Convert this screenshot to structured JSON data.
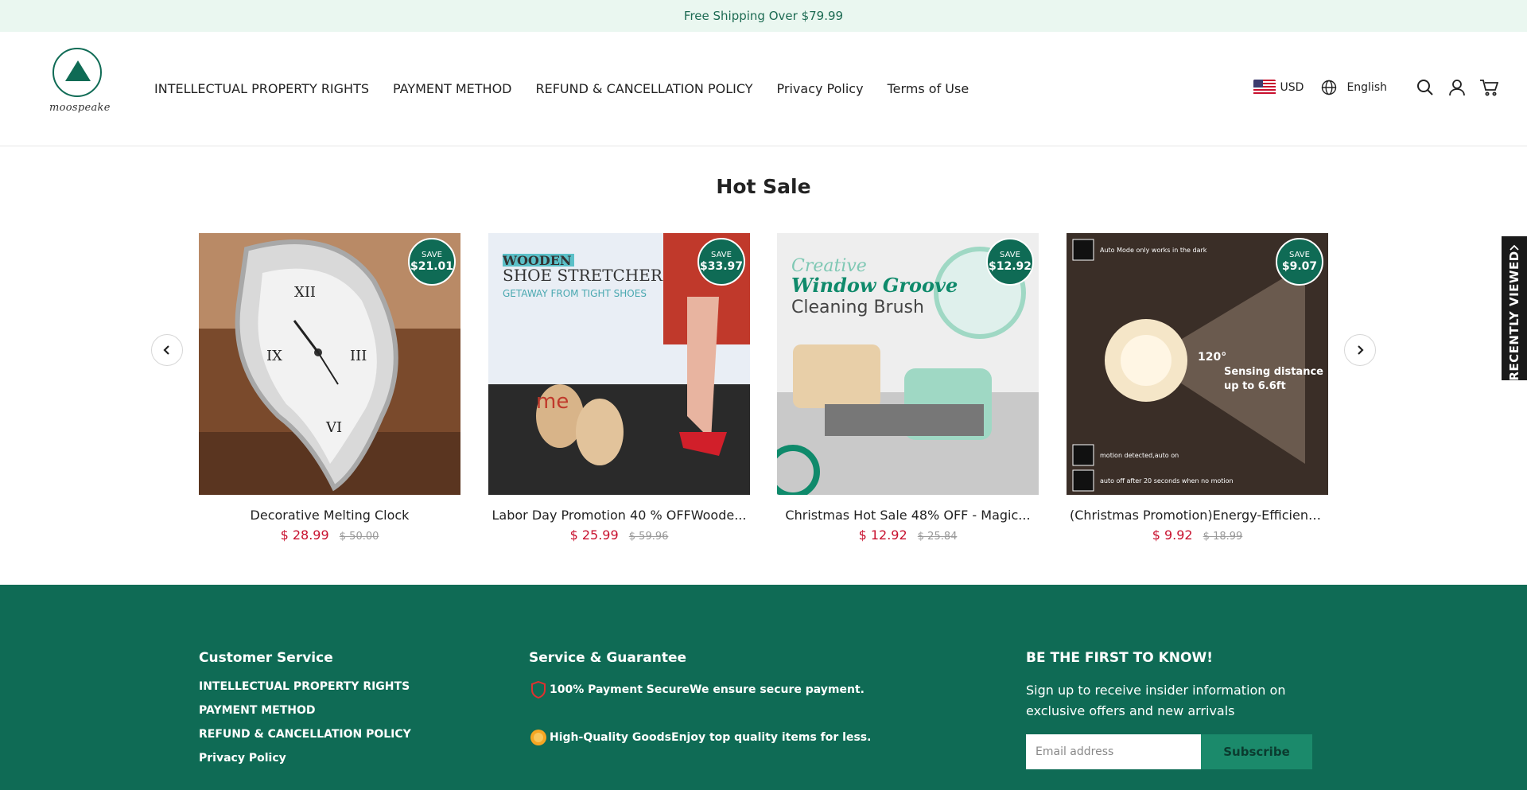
{
  "announcement": {
    "text": "Free Shipping Over $79.99"
  },
  "brand": {
    "name": "moospeake"
  },
  "nav": {
    "items": [
      {
        "label": "INTELLECTUAL PROPERTY RIGHTS"
      },
      {
        "label": "PAYMENT METHOD"
      },
      {
        "label": "REFUND & CANCELLATION POLICY"
      },
      {
        "label": "Privacy Policy"
      },
      {
        "label": "Terms of Use"
      }
    ]
  },
  "utility": {
    "currency": "USD",
    "language": "English",
    "icons": [
      "us-flag-icon",
      "globe-icon",
      "search-icon",
      "account-icon",
      "cart-icon"
    ]
  },
  "section": {
    "title": "Hot Sale"
  },
  "products": [
    {
      "name": "Decorative Melting Clock",
      "price": "$ 28.99",
      "compare": "$ 50.00",
      "save_label": "SAVE",
      "save": "$21.01"
    },
    {
      "name": "Labor Day Promotion 40 % OFFWoode...",
      "price": "$ 25.99",
      "compare": "$ 59.96",
      "save_label": "SAVE",
      "save": "$33.97"
    },
    {
      "name": "Christmas Hot Sale 48% OFF - Magic...",
      "price": "$ 12.92",
      "compare": "$ 25.84",
      "save_label": "SAVE",
      "save": "$12.92"
    },
    {
      "name": "(Christmas Promotion)Energy-Efficient LE...",
      "price": "$ 9.92",
      "compare": "$ 18.99",
      "save_label": "SAVE",
      "save": "$9.07"
    }
  ],
  "product_images": {
    "p2": {
      "line1": "WOODEN",
      "line2": "SHOE STRETCHER",
      "line3": "GETAWAY FROM TIGHT SHOES"
    },
    "p3": {
      "line1": "Creative",
      "line2": "Window Groove",
      "line3": "Cleaning Brush"
    },
    "p4": {
      "top": "Auto Mode only works in the dark",
      "angle": "120°",
      "sense1": "Sensing distance",
      "sense2": "up to 6.6ft",
      "motion": "motion detected,auto on",
      "autooff": "auto off after 20 seconds when no motion"
    }
  },
  "recently_viewed": {
    "label": "RECENTLY VIEWED"
  },
  "footer": {
    "customer_service": {
      "title": "Customer Service",
      "links": [
        "INTELLECTUAL PROPERTY RIGHTS",
        "PAYMENT METHOD",
        "REFUND & CANCELLATION POLICY",
        "Privacy Policy"
      ]
    },
    "guarantee": {
      "title": "Service & Guarantee",
      "items": [
        {
          "text": "100% Payment SecureWe ensure secure payment."
        },
        {
          "text": "High-Quality GoodsEnjoy top quality items for less."
        }
      ]
    },
    "newsletter": {
      "title": "BE THE FIRST TO KNOW!",
      "text": "Sign up to receive insider information on exclusive offers and new arrivals",
      "placeholder": "Email address",
      "button": "Subscribe"
    }
  },
  "colors": {
    "brand": "#0f6b55",
    "sale": "#c8102e",
    "announce_bg": "#eaf7f0"
  }
}
